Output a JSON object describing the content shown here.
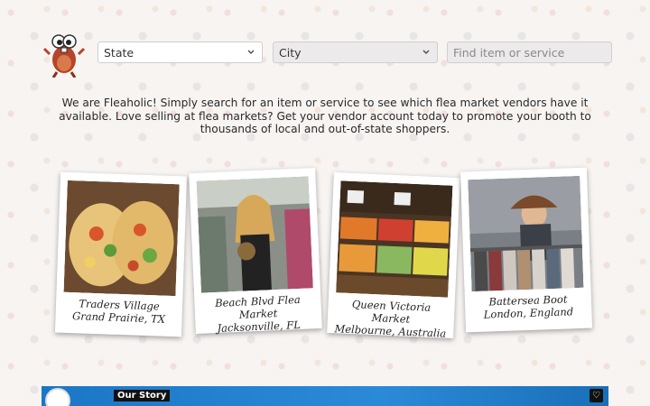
{
  "header": {
    "state_select": {
      "value": "State"
    },
    "city_select": {
      "value": "City"
    },
    "search": {
      "placeholder": "Find item or service"
    }
  },
  "intro_text": "We are Fleaholic! Simply search for an item or service to see which flea market vendors have it available. Love selling at flea markets? Get your vendor account today to promote your booth to thousands of local and out-of-state shoppers.",
  "markets": [
    {
      "line1": "Traders Village",
      "line2": "Grand Prairie, TX"
    },
    {
      "line1": "Beach Blvd Flea Market",
      "line2": "Jacksonville, FL"
    },
    {
      "line1": "Queen Victoria Market",
      "line2": "Melbourne, Australia"
    },
    {
      "line1": "Battersea Boot",
      "line2": "London, England"
    }
  ],
  "story": {
    "label": "Our Story"
  }
}
